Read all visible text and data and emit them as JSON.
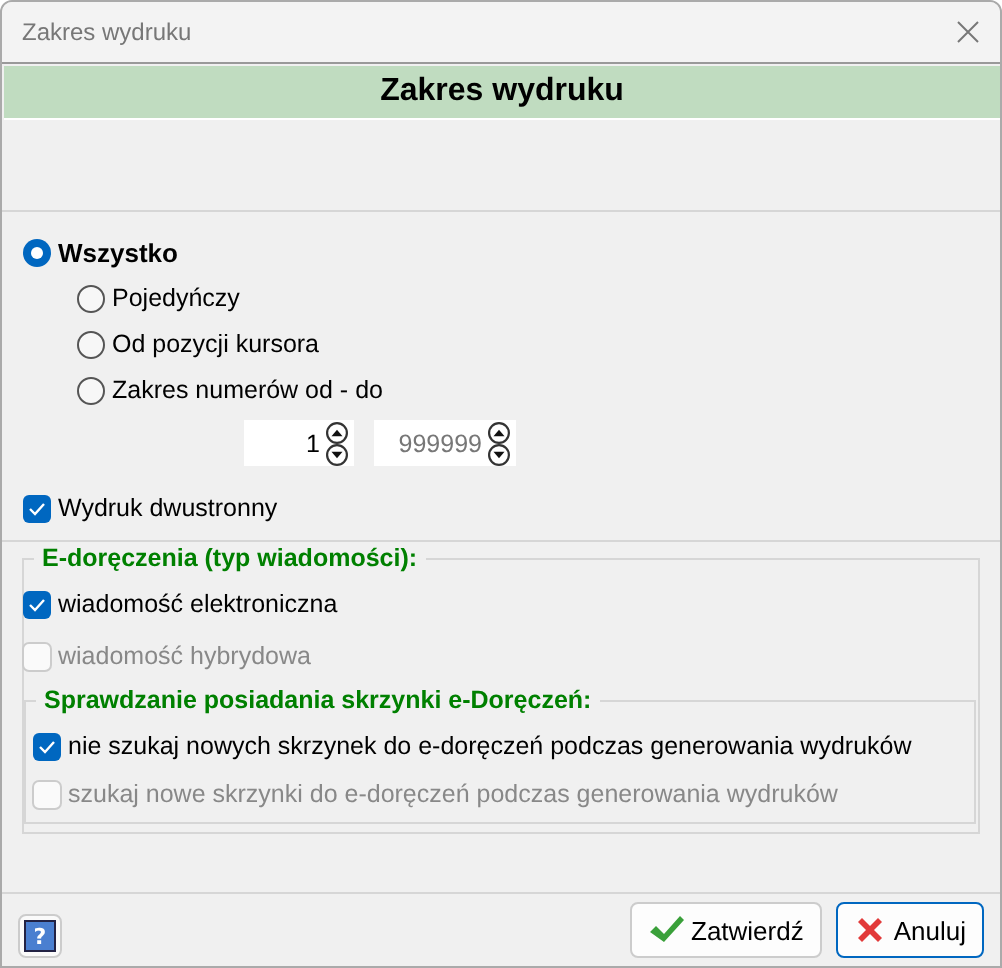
{
  "window": {
    "title": "Zakres wydruku"
  },
  "header": {
    "title": "Zakres wydruku"
  },
  "range_options": [
    {
      "label": "Wszystko",
      "selected": true,
      "primary": true
    },
    {
      "label": "Pojedyńczy",
      "selected": false,
      "primary": false
    },
    {
      "label": "Od pozycji kursora",
      "selected": false,
      "primary": false
    },
    {
      "label": "Zakres numerów od - do",
      "selected": false,
      "primary": false
    }
  ],
  "range_from": {
    "value": "1",
    "disabled": false
  },
  "range_to": {
    "value": "999999",
    "disabled": true
  },
  "duplex": {
    "label": "Wydruk dwustronny",
    "checked": true,
    "disabled": false
  },
  "e_delivery": {
    "title": "E-doręczenia (typ wiadomości):",
    "options": [
      {
        "label": "wiadomość elektroniczna",
        "checked": true,
        "disabled": false
      },
      {
        "label": "wiadomość hybrydowa",
        "checked": false,
        "disabled": true
      }
    ],
    "mailbox_check": {
      "title": "Sprawdzanie posiadania skrzynki e-Doręczeń:",
      "options": [
        {
          "label": "nie szukaj nowych skrzynek do e-doręczeń podczas generowania wydruków",
          "checked": true,
          "disabled": false
        },
        {
          "label": "szukaj nowe skrzynki do e-doręczeń podczas generowania wydruków",
          "checked": false,
          "disabled": true
        }
      ]
    }
  },
  "footer": {
    "help": "?",
    "buttons": [
      {
        "label": "Zatwierdź",
        "kind": "ok"
      },
      {
        "label": "Anuluj",
        "kind": "cancel"
      }
    ]
  }
}
